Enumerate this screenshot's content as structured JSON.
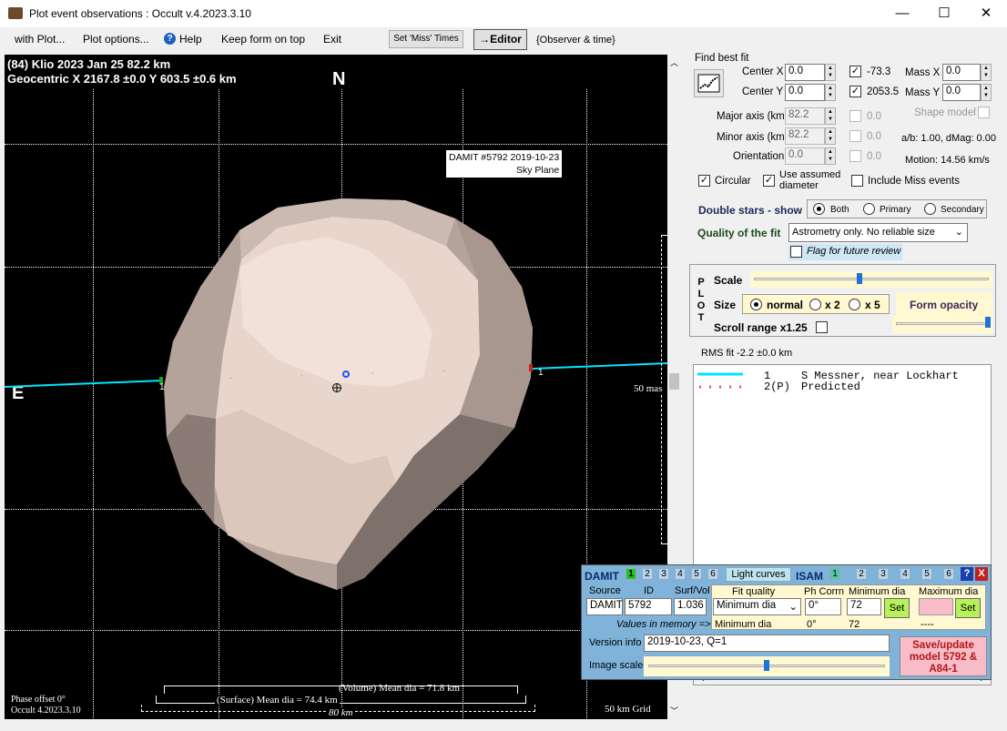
{
  "window": {
    "title": "Plot event observations : Occult v.4.2023.3.10",
    "minimize": "—",
    "maximize": "☐",
    "close": "✕"
  },
  "menu": {
    "with_plot": "with Plot...",
    "plot_options": "Plot options...",
    "help": "Help",
    "keep_on_top": "Keep form on top",
    "exit": "Exit",
    "set_miss": "Set 'Miss' Times",
    "editor": "→Editor",
    "observer_time": "{Observer & time}"
  },
  "plot": {
    "header1": "(84) Klio  2023 Jan 25   82.2 km",
    "header2": "Geocentric  X  2167.8 ±0.0  Y  603.5 ±0.6 km",
    "north": "N",
    "east": "E",
    "damit_label1": "DAMIT #5792 2019-10-23",
    "damit_label2": "Sky Plane",
    "mas_label": "50 mas",
    "chord_marker": "1",
    "volume_dia": "(Volume) Mean dia = 71.8 km",
    "surface_dia": "(Surface) Mean dia = 74.4 km",
    "km_label": "80 km",
    "phase_offset": "Phase offset 0°",
    "version": "Occult 4.2023.3.10",
    "grid": "50 km Grid",
    "shape_color": "#c9bab1"
  },
  "fit": {
    "find_best_fit": "Find best fit",
    "center_x_label": "Center X",
    "center_x": "0.0",
    "center_y_label": "Center Y",
    "center_y": "0.0",
    "x_result": "-73.3",
    "y_result": "2053.5",
    "mass_x_label": "Mass X",
    "mass_x": "0.0",
    "mass_y_label": "Mass Y",
    "mass_y": "0.0",
    "major_label": "Major axis (km)",
    "major": "82.2",
    "major_r": "0.0",
    "minor_label": "Minor axis (km)",
    "minor": "82.2",
    "minor_r": "0.0",
    "orient_label": "Orientation",
    "orient": "0.0",
    "orient_r": "0.0",
    "shape_model": "Shape model",
    "ab_dmag": "a/b: 1.00, dMag: 0.00",
    "motion": "Motion: 14.56 km/s",
    "circular": "Circular",
    "use_assumed1": "Use assumed",
    "use_assumed2": "diameter",
    "include_miss": "Include Miss events",
    "double_stars": "Double stars - show",
    "both": "Both",
    "primary": "Primary",
    "secondary": "Secondary",
    "quality_label": "Quality of the fit",
    "quality_value": "Astrometry only. No reliable size",
    "flag_review": "Flag for future review"
  },
  "plotbox": {
    "letters": [
      "P",
      "L",
      "O",
      "T"
    ],
    "scale": "Scale",
    "size": "Size",
    "normal": "normal",
    "x2": "x 2",
    "x5": "x 5",
    "form_opacity": "Form opacity",
    "scroll_range": "Scroll range x1.25",
    "scale_level": 0.45,
    "opacity_level": 1.0
  },
  "rms": "RMS fit -2.2 ±0.0 km",
  "legend": [
    {
      "num": "1",
      "name": "S Messner, near Lockhart",
      "color": "#00e5ff"
    },
    {
      "num": "2(P)",
      "name": "Predicted",
      "color": "#e0507f"
    }
  ],
  "damit": {
    "damit_tab": "DAMIT",
    "nums": [
      "1",
      "2",
      "3",
      "4",
      "5",
      "6"
    ],
    "light_curves": "Light curves",
    "isam_tab": "ISAM",
    "hdr_source": "Source",
    "hdr_id": "ID",
    "hdr_surfvol": "Surf/Vol",
    "source": "DAMIT",
    "id": "5792",
    "surfvol": "1.036",
    "values_in_memory": "Values in memory =>",
    "hdr_fitq": "Fit quality",
    "hdr_phcorr": "Ph Corrn",
    "hdr_mindia": "Minimum dia",
    "hdr_maxdia": "Maximum dia",
    "fitq_value": "Minimum dia",
    "phcorr": "0°",
    "mindia": "72",
    "set": "Set",
    "mem_fitq": "Minimum dia",
    "mem_phcorr": "0°",
    "mem_mindia": "72",
    "mem_maxdia": "----",
    "version_label": "Version info",
    "version_value": "2019-10-23, Q=1",
    "image_scale": "Image scale",
    "image_scale_level": 0.5,
    "save_button": "Save/update model 5792 & A84-1",
    "help": "?",
    "close": "X"
  }
}
